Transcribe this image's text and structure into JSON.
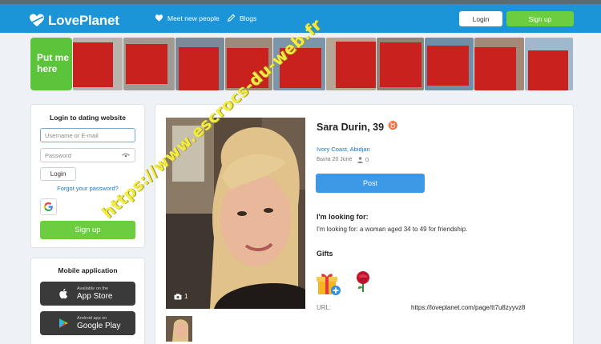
{
  "header": {
    "brand": "LovePlanet",
    "nav": [
      {
        "label": "Meet new people",
        "icon": "heart-icon"
      },
      {
        "label": "Blogs",
        "icon": "pencil-icon"
      }
    ],
    "login_label": "Login",
    "signup_label": "Sign up"
  },
  "strip": {
    "cta": "Put me here"
  },
  "login_card": {
    "title": "Login to dating website",
    "username_placeholder": "Username or E-mail",
    "password_placeholder": "Password",
    "login_button": "Login",
    "forgot": "Forgot your password?",
    "social_icon": "google-icon",
    "signup_button": "Sign up"
  },
  "mobile_card": {
    "title": "Mobile application",
    "stores": [
      {
        "small": "Available on the",
        "big": "App Store",
        "icon": "apple-icon"
      },
      {
        "small": "Android app on",
        "big": "Google Play",
        "icon": "google-play-icon"
      }
    ]
  },
  "profile": {
    "name": "Sara Durin, 39",
    "zodiac": "♉",
    "location": "Ivory Coast, Abidjan",
    "was_online": "Была 20 June",
    "views": "0",
    "photo_count": "1",
    "post_button": "Post",
    "looking_heading": "I'm looking for:",
    "looking_text": "I'm looking for: a woman aged 34 to 49 for friendship.",
    "gifts_heading": "Gifts",
    "url_label": "URL:",
    "url_value": "https://loveplanet.com/page/tt7u8zyyvz8"
  },
  "watermark": "https://www.escrocs-du-web.fr",
  "colors": {
    "header": "#1b95d8",
    "accent_green": "#6bcd3f",
    "post_blue": "#3d98e6",
    "link_blue": "#1a75c4",
    "redaction": "#c9211e",
    "watermark": "#f1ec45"
  }
}
